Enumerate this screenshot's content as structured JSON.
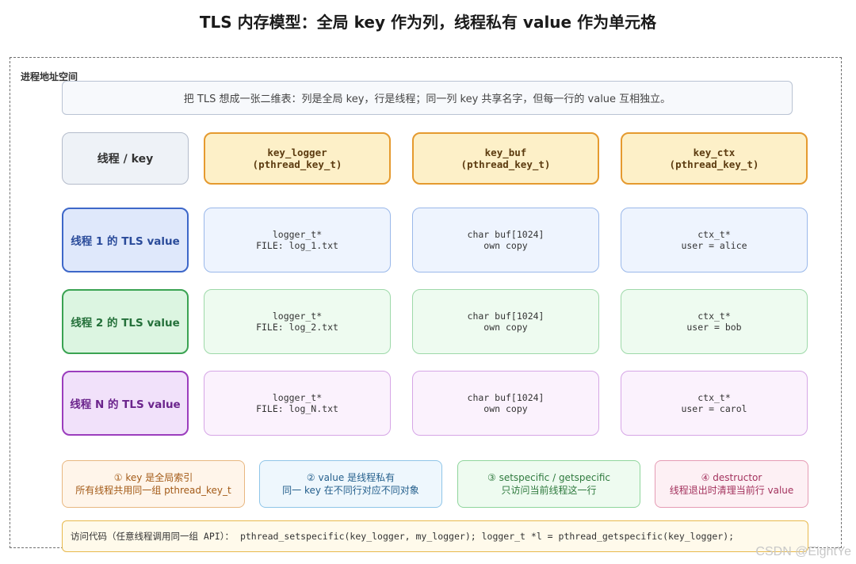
{
  "title": "TLS 内存模型：全局 key 作为列，线程私有 value 作为单元格",
  "frame_label": "进程地址空间",
  "intro": "把 TLS 想成一张二维表：列是全局 key，行是线程；同一列 key 共享名字，但每一行的 value 互相独立。",
  "corner": "线程 / key",
  "keys": [
    {
      "name": "key_logger",
      "type": "(pthread_key_t)"
    },
    {
      "name": "key_buf",
      "type": "(pthread_key_t)"
    },
    {
      "name": "key_ctx",
      "type": "(pthread_key_t)"
    }
  ],
  "rows": [
    {
      "label": "线程 1 的 TLS value",
      "cells": [
        {
          "line1": "logger_t*",
          "line2": "FILE: log_1.txt"
        },
        {
          "line1": "char buf[1024]",
          "line2": "own copy"
        },
        {
          "line1": "ctx_t*",
          "line2": "user = alice"
        }
      ]
    },
    {
      "label": "线程 2 的 TLS value",
      "cells": [
        {
          "line1": "logger_t*",
          "line2": "FILE: log_2.txt"
        },
        {
          "line1": "char buf[1024]",
          "line2": "own copy"
        },
        {
          "line1": "ctx_t*",
          "line2": "user = bob"
        }
      ]
    },
    {
      "label": "线程 N 的 TLS value",
      "cells": [
        {
          "line1": "logger_t*",
          "line2": "FILE: log_N.txt"
        },
        {
          "line1": "char buf[1024]",
          "line2": "own copy"
        },
        {
          "line1": "ctx_t*",
          "line2": "user = carol"
        }
      ]
    }
  ],
  "notes": [
    {
      "line1": "① key 是全局索引",
      "line2": "所有线程共用同一组 pthread_key_t"
    },
    {
      "line1": "② value 是线程私有",
      "line2": "同一 key 在不同行对应不同对象"
    },
    {
      "line1": "③ setspecific / getspecific",
      "line2": "只访问当前线程这一行"
    },
    {
      "line1": "④ destructor",
      "line2": "线程退出时清理当前行 value"
    }
  ],
  "code": {
    "label": "访问代码（任意线程调用同一组 API）：",
    "text": "pthread_setspecific(key_logger, my_logger); logger_t *l = pthread_getspecific(key_logger);"
  },
  "watermark": "CSDN @EightYe"
}
